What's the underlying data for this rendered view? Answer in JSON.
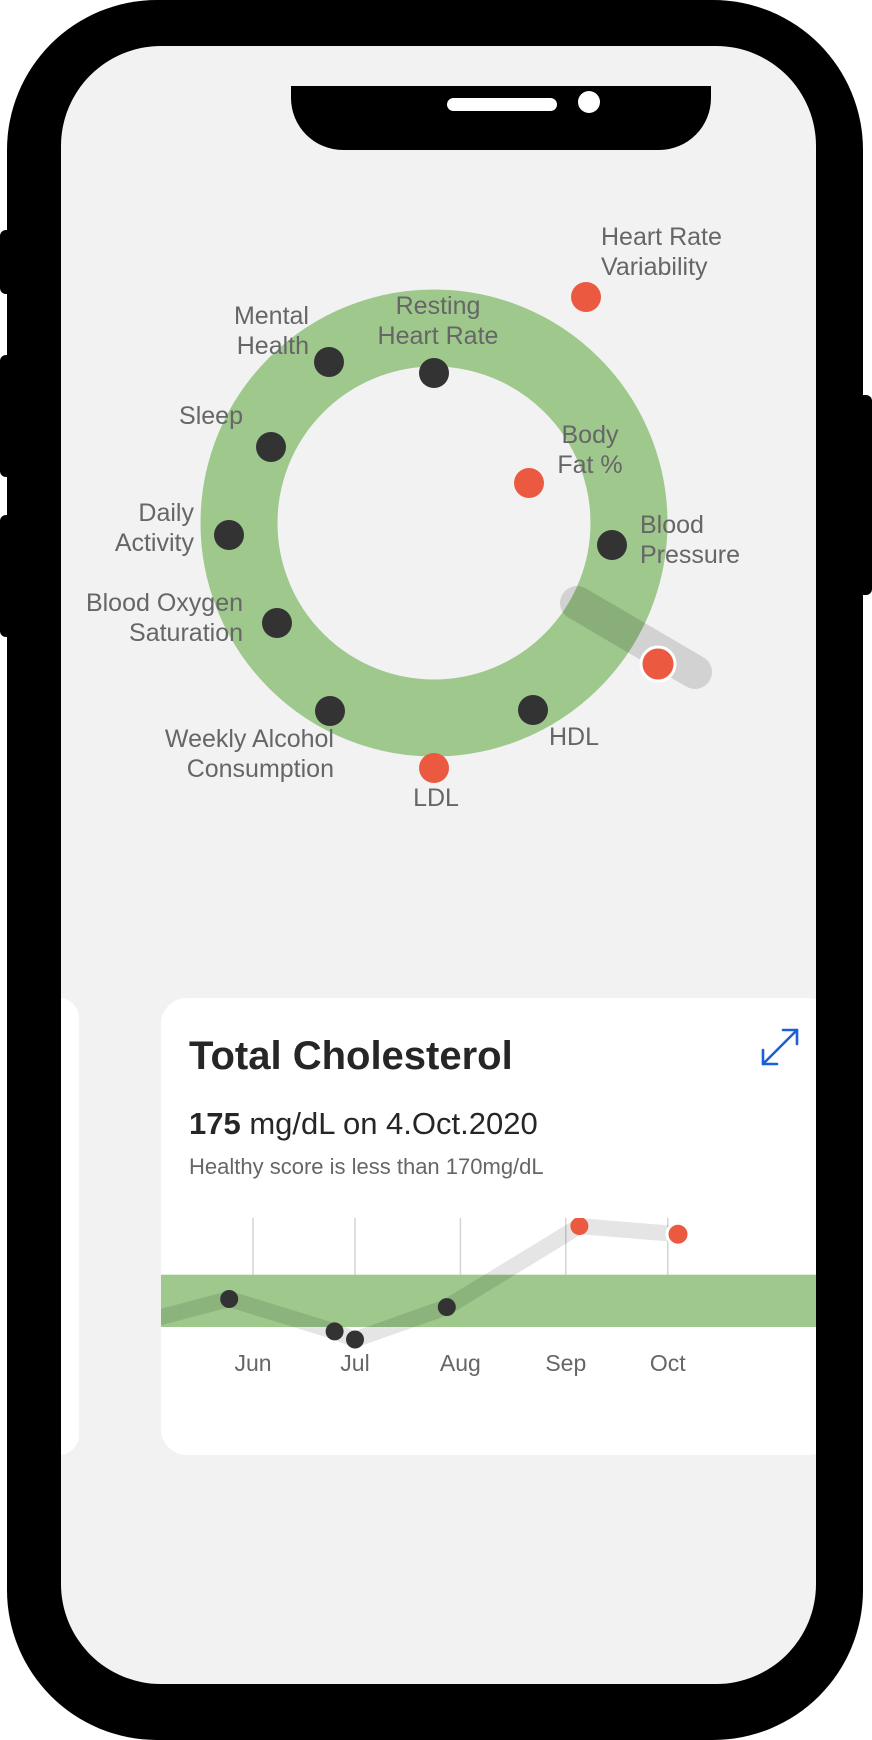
{
  "colors": {
    "ring_green": "#9ec88c",
    "healthy_band_green": "#9ec88c",
    "marker_dark": "#333333",
    "marker_alert": "#eb5a40",
    "accent_blue": "#1a5fd6",
    "background": "#f2f2f2"
  },
  "health_ring": {
    "metrics": [
      {
        "label": "Heart Rate\nVariability",
        "status": "out_of_range"
      },
      {
        "label": "Resting\nHeart Rate",
        "status": "in_range"
      },
      {
        "label": "Mental\nHealth",
        "status": "in_range"
      },
      {
        "label": "Sleep",
        "status": "in_range"
      },
      {
        "label": "Body\nFat %",
        "status": "out_of_range"
      },
      {
        "label": "Daily\nActivity",
        "status": "in_range"
      },
      {
        "label": "Blood\nPressure",
        "status": "in_range"
      },
      {
        "label": "Blood Oxygen\nSaturation",
        "status": "in_range"
      },
      {
        "label": "Total Cholesterol",
        "status": "out_of_range",
        "selected": true
      },
      {
        "label": "HDL",
        "status": "in_range"
      },
      {
        "label": "Weekly Alcohol\nConsumption",
        "status": "in_range"
      },
      {
        "label": "LDL",
        "status": "out_of_range"
      }
    ]
  },
  "card": {
    "title": "Total Cholesterol",
    "value": "175",
    "unit_date": " mg/dL on 4.Oct.2020",
    "subtitle": "Healthy score is less than 170mg/dL",
    "expand_icon": "expand-arrows-icon"
  },
  "chart_data": {
    "type": "line",
    "x_ticks": [
      "Jun",
      "Jul",
      "Aug",
      "Sep",
      "Oct"
    ],
    "healthy_range": {
      "max": 170
    },
    "series": [
      {
        "values": [
          {
            "date": "May 25",
            "value": 167,
            "status": "in_range"
          },
          {
            "date": "Jun 25",
            "value": 163,
            "status": "in_range"
          },
          {
            "date": "Jul 1",
            "value": 162,
            "status": "in_range"
          },
          {
            "date": "Jul 28",
            "value": 166,
            "status": "in_range"
          },
          {
            "date": "Sep 5",
            "value": 176,
            "status": "out_of_range"
          },
          {
            "date": "Oct 4",
            "value": 175,
            "status": "out_of_range"
          }
        ]
      }
    ]
  }
}
